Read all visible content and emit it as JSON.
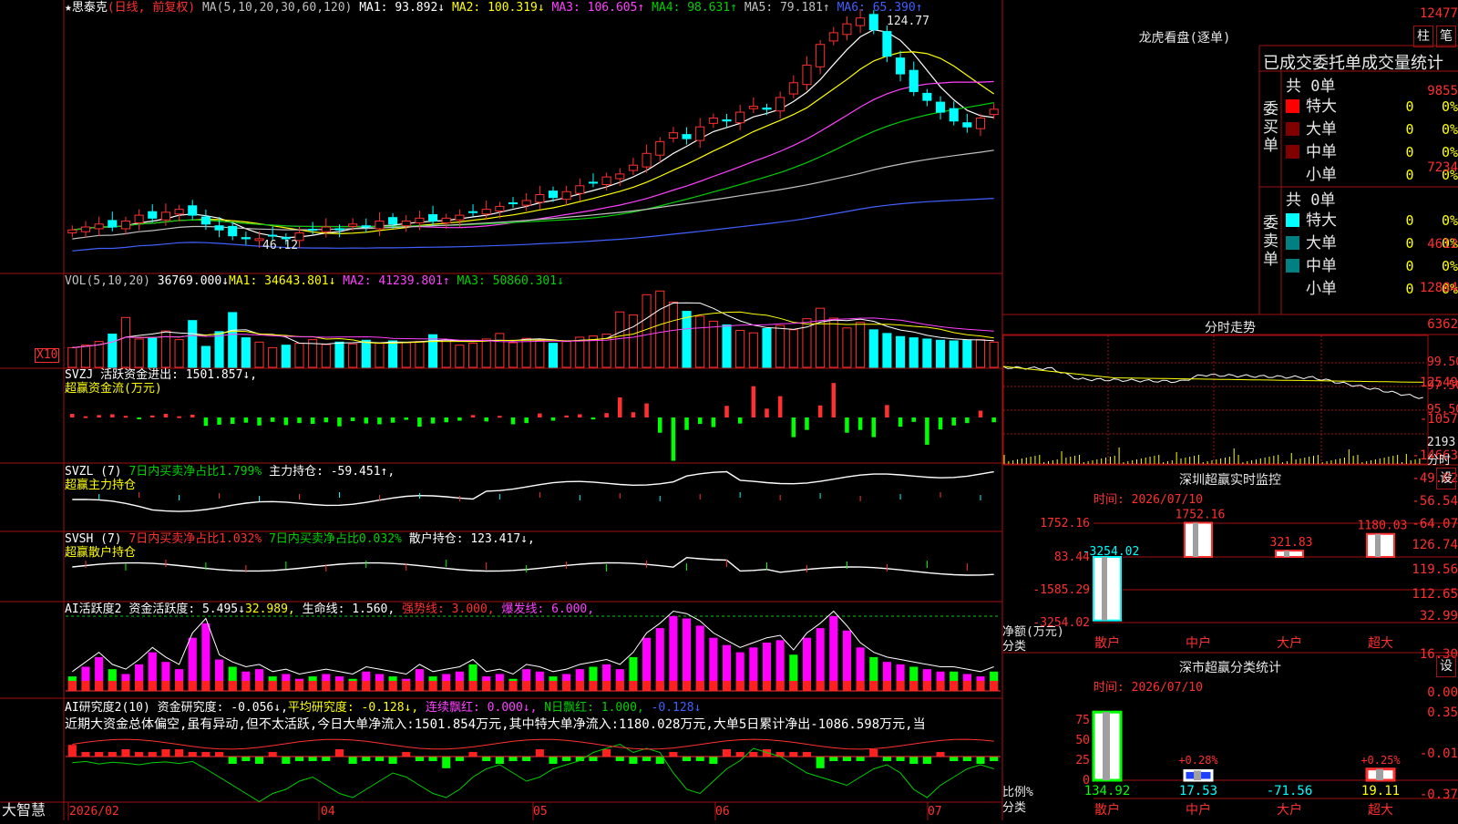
{
  "main_chart": {
    "stock_star": "★",
    "stock_name": "思泰克",
    "period": "(日线, 前复权)",
    "ma_label": "MA(5,10,20,30,60,120)",
    "ma_values": [
      "MA1: 93.892↓",
      "MA2: 100.319↓",
      "MA3: 106.605↑",
      "MA4: 98.631↑",
      "MA5: 79.181↑",
      "MA6: 65.390↑"
    ],
    "ma_colors": [
      "#ffffff",
      "#ffff00",
      "#ff40ff",
      "#00d000",
      "#c0c0c0",
      "#4060ff"
    ],
    "y_axis_labels": [
      "12477",
      "9855",
      "7234",
      "4612"
    ],
    "high_mark": "124.77",
    "low_mark": "46.12"
  },
  "volume": {
    "label": "VOL(5,10,20)",
    "value": "36769.000↓",
    "ma1": "MA1: 34643.801↓",
    "ma2": "MA2: 41239.801↑",
    "ma3": "MA3: 50860.301↓",
    "y_axis_labels": [
      "12884",
      "6362"
    ],
    "unit": "X10"
  },
  "svzj": {
    "label": "SVZJ",
    "desc": "活跃资金进出: 1501.857↓,",
    "sub": "超赢资金流(万元)",
    "y_axis_labels": [
      "12549",
      "-1057",
      "-14663"
    ]
  },
  "svzl": {
    "label": "SVZL (7)",
    "a": "7日内买卖净占比1.799%",
    "b": "主力持仓: -59.451↑,",
    "sub": "超赢主力持仓",
    "y_axis_labels": [
      "-49.02",
      "-56.54",
      "-64.07"
    ]
  },
  "svsh": {
    "label": "SVSH (7)",
    "a": "7日内买卖净占比1.032%",
    "b": "7日内买卖净占比0.032%",
    "c": "散户持仓: 123.417↓,",
    "sub": "超赢散户持仓",
    "y_axis_labels": [
      "126.74",
      "119.56",
      "112.65"
    ]
  },
  "ai_active": {
    "label": "AI活跃度2",
    "a": "资金活跃度: 5.495↓",
    "b": "32.989,",
    "c": "生命线: 1.560,",
    "d": "强势线: 3.000,",
    "e": "爆发线: 6.000,",
    "y_axis_labels": [
      "32.99",
      "16.30",
      "0.00"
    ]
  },
  "ai_research": {
    "label": "AI研究度2(10)",
    "a": "资金研究度: -0.056↓,",
    "b": "平均研究度: -0.128↓,",
    "c": "连续飘红: 0.000↓,",
    "d": "N日飘红: 1.000,",
    "e": "-0.128↓",
    "commentary": "近期大资金总体偏空,虽有异动,但不太活跃,今日大单净流入:1501.854万元,其中特大单净流入:1180.028万元,大单5日累计净出-1086.598万元,当",
    "y_axis_labels": [
      "0.35",
      "-0.01",
      "-0.37"
    ]
  },
  "bottom": {
    "brand": "大智慧",
    "x_axis_labels": [
      "2026/02",
      "04",
      "05",
      "06",
      "07"
    ]
  },
  "panel_lhb": {
    "title": "龙虎看盘(逐单)",
    "btn1": "柱",
    "btn2": "笔",
    "header": "已成交委托单成交量统计",
    "buy_label": "委买单",
    "sell_label": "委卖单",
    "buy_total": "共 0单",
    "sell_total": "共 0单",
    "rows": [
      {
        "name": "特大",
        "count": "0",
        "pct": "0%"
      },
      {
        "name": "大单",
        "count": "0",
        "pct": "0%"
      },
      {
        "name": "中单",
        "count": "0",
        "pct": "0%"
      },
      {
        "name": "小单",
        "count": "0",
        "pct": "0%"
      }
    ]
  },
  "panel_fs": {
    "title": "分时走势",
    "y_labels": [
      "99.50",
      "97.50",
      "95.50"
    ],
    "vol_label": "2193",
    "vol_sub": "分时"
  },
  "panel_sz": {
    "title": "深圳超赢实时监控",
    "btn": "设",
    "date": "时间: 2026/07/10",
    "y_labels": [
      "1752.16",
      "83.44",
      "-1585.29",
      "-3254.02"
    ],
    "y_title": "净额(万元)",
    "x_title": "分类",
    "cats": [
      "散户",
      "中户",
      "大户",
      "超大"
    ],
    "values": [
      -3254.02,
      1752.16,
      321.83,
      1180.03
    ],
    "value_labels": [
      "-3254.02",
      "1752.16",
      "321.83",
      "1180.03"
    ]
  },
  "panel_fl": {
    "title": "深市超赢分类统计",
    "btn": "设",
    "date": "时间: 2026/07/10",
    "y_labels": [
      "75",
      "50",
      "25",
      "0"
    ],
    "y_title": "比例%",
    "x_title": "分类",
    "cats": [
      "散户",
      "中户",
      "大户",
      "超大"
    ],
    "pct_labels": [
      "+0.28%",
      "+0.25%"
    ],
    "values": [
      "134.92",
      "17.53",
      "-71.56",
      "19.11"
    ]
  },
  "chart_data": [
    {
      "type": "candlestick",
      "title": "思泰克(日线, 前复权)",
      "ylim": [
        4612,
        12477
      ],
      "x_axis_labels": [
        "2026/02",
        "04",
        "05",
        "06",
        "07"
      ],
      "close": [
        51,
        52,
        53,
        52,
        54,
        56,
        55,
        57,
        58,
        56,
        53,
        51,
        49,
        48,
        48,
        49,
        48,
        50,
        51,
        52,
        51,
        53,
        52,
        54,
        53,
        54,
        55,
        54,
        55,
        56,
        57,
        58,
        59,
        60,
        61,
        63,
        62,
        64,
        66,
        67,
        69,
        70,
        73,
        77,
        81,
        84,
        82,
        86,
        89,
        88,
        91,
        93,
        92,
        96,
        101,
        107,
        114,
        118,
        121,
        123,
        119,
        110,
        104,
        98,
        95,
        91,
        88,
        86,
        89,
        92
      ]
    },
    {
      "type": "bar",
      "title": "VOL(5,10,20)",
      "ylim": [
        0,
        12884
      ],
      "values": [
        3.2,
        3.6,
        4.2,
        5.4,
        8.1,
        4.6,
        4.8,
        5.9,
        4.5,
        7.6,
        3.4,
        5.8,
        8.9,
        4.8,
        4.1,
        3.2,
        3.6,
        3.9,
        4.5,
        3.7,
        4.1,
        3.8,
        4.4,
        3.9,
        4.3,
        4.0,
        4.2,
        5.3,
        4.4,
        3.6,
        3.9,
        4.6,
        5.5,
        4.0,
        4.7,
        4.3,
        3.9,
        4.2,
        4.9,
        5.1,
        5.4,
        9.0,
        8.5,
        11.8,
        12.4,
        10.6,
        9.1,
        8.3,
        7.5,
        6.9,
        6.0,
        5.6,
        6.3,
        6.8,
        6.1,
        7.9,
        9.6,
        8.0,
        6.4,
        7.3,
        6.1,
        5.5,
        5.0,
        4.8,
        4.6,
        4.4,
        4.3,
        4.4,
        4.5,
        4.1
      ]
    },
    {
      "type": "bar",
      "title": "超赢资金流(万元)",
      "ylim": [
        -14663,
        12549
      ],
      "values": [
        0.9,
        0.3,
        0.6,
        0.8,
        0.4,
        -0.2,
        0.5,
        0.9,
        0.3,
        0.7,
        -2.1,
        -1.8,
        -1.6,
        -1.3,
        -2.0,
        -1.1,
        -1.9,
        -1.4,
        -1.6,
        -1.2,
        -2.2,
        -0.9,
        -1.5,
        -1.7,
        -1.3,
        -0.6,
        -2.3,
        -1.5,
        -1.2,
        -0.8,
        0.6,
        -1.0,
        0.4,
        -1.7,
        -1.4,
        1.0,
        -0.8,
        0.5,
        0.8,
        -0.5,
        1.1,
        5.0,
        1.3,
        3.5,
        -3.8,
        -10.8,
        -3.1,
        -1.6,
        -2.4,
        2.9,
        -1.5,
        7.8,
        2.2,
        5.3,
        -4.9,
        -3.1,
        3.0,
        8.6,
        -3.8,
        -3.1,
        -4.9,
        3.1,
        -2.3,
        -1.1,
        -6.8,
        -3.0,
        -2.0,
        -1.4,
        1.7,
        -1.2
      ]
    }
  ]
}
